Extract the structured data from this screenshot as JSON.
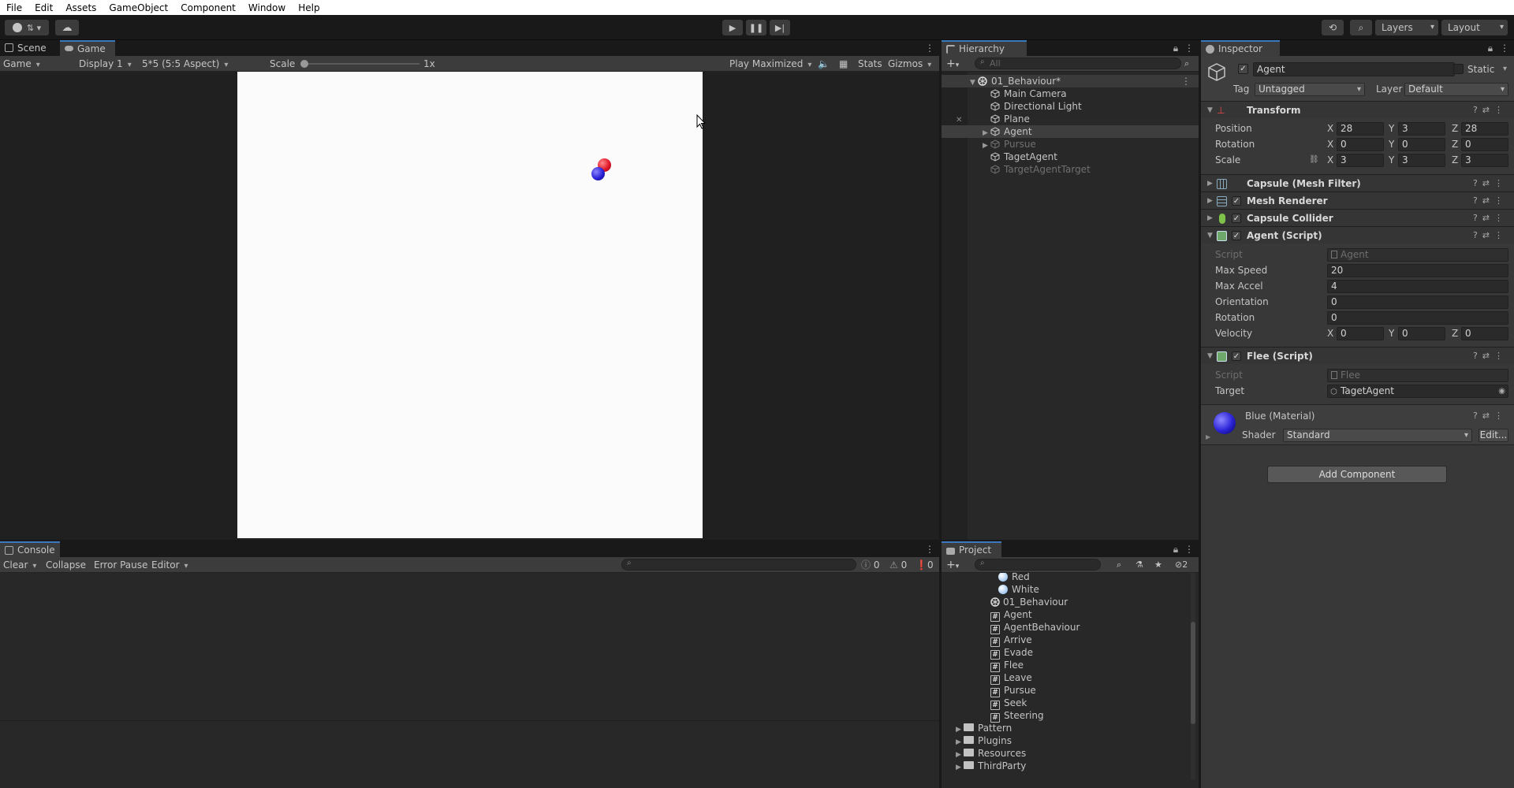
{
  "menu": [
    "File",
    "Edit",
    "Assets",
    "GameObject",
    "Component",
    "Window",
    "Help"
  ],
  "toolbar": {
    "layers": "Layers",
    "layout": "Layout"
  },
  "scene_tabs": {
    "scene": "Scene",
    "game": "Game"
  },
  "game_toolbar": {
    "mode": "Game",
    "display": "Display 1",
    "aspect": "5*5 (5:5 Aspect)",
    "scale_label": "Scale",
    "scale_value": "1x",
    "play_mode": "Play Maximized",
    "stats": "Stats",
    "gizmos": "Gizmos"
  },
  "game_view": {
    "background": "#fbfbfb",
    "agent_color": "#2a22d6",
    "target_color": "#e0192b"
  },
  "hierarchy": {
    "tab": "Hierarchy",
    "search_placeholder": "All",
    "items": [
      {
        "label": "01_Behaviour*",
        "depth": 0,
        "scene": true
      },
      {
        "label": "Main Camera",
        "depth": 1
      },
      {
        "label": "Directional Light",
        "depth": 1
      },
      {
        "label": "Plane",
        "depth": 1
      },
      {
        "label": "Agent",
        "depth": 1,
        "selected": true,
        "expandable": true
      },
      {
        "label": "Pursue",
        "depth": 1,
        "dim": true,
        "expandable": true
      },
      {
        "label": "TagetAgent",
        "depth": 1
      },
      {
        "label": "TargetAgentTarget",
        "depth": 1,
        "dim": true
      }
    ]
  },
  "inspector": {
    "tab": "Inspector",
    "object_name": "Agent",
    "static_label": "Static",
    "tag_label": "Tag",
    "tag_value": "Untagged",
    "layer_label": "Layer",
    "layer_value": "Default",
    "transform": {
      "title": "Transform",
      "position": {
        "label": "Position",
        "x": "28",
        "y": "3",
        "z": "28"
      },
      "rotation": {
        "label": "Rotation",
        "x": "0",
        "y": "0",
        "z": "0"
      },
      "scale": {
        "label": "Scale",
        "x": "3",
        "y": "3",
        "z": "3"
      }
    },
    "components": {
      "mesh_filter": "Capsule (Mesh Filter)",
      "mesh_renderer": "Mesh Renderer",
      "capsule_collider": "Capsule Collider",
      "agent_script": "Agent (Script)",
      "flee_script": "Flee (Script)"
    },
    "agent": {
      "script_label": "Script",
      "script_value": "Agent",
      "max_speed_label": "Max Speed",
      "max_speed": "20",
      "max_accel_label": "Max Accel",
      "max_accel": "4",
      "orientation_label": "Orientation",
      "orientation": "0",
      "rotation_label": "Rotation",
      "rotation": "0",
      "velocity_label": "Velocity",
      "vx": "0",
      "vy": "0",
      "vz": "0"
    },
    "flee": {
      "script_label": "Script",
      "script_value": "Flee",
      "target_label": "Target",
      "target_value": "TagetAgent"
    },
    "material": {
      "name": "Blue (Material)",
      "shader_label": "Shader",
      "shader_value": "Standard",
      "edit": "Edit..."
    },
    "add_component": "Add Component"
  },
  "console": {
    "tab": "Console",
    "clear": "Clear",
    "collapse": "Collapse",
    "error_pause": "Error Pause",
    "editor": "Editor",
    "logs": "0",
    "warnings": "0",
    "errors": "0"
  },
  "project": {
    "tab": "Project",
    "hidden_count": "2",
    "items": [
      {
        "label": "Red",
        "type": "material"
      },
      {
        "label": "White",
        "type": "material"
      },
      {
        "label": "01_Behaviour",
        "type": "scene"
      },
      {
        "label": "Agent",
        "type": "script"
      },
      {
        "label": "AgentBehaviour",
        "type": "script"
      },
      {
        "label": "Arrive",
        "type": "script"
      },
      {
        "label": "Evade",
        "type": "script"
      },
      {
        "label": "Flee",
        "type": "script"
      },
      {
        "label": "Leave",
        "type": "script"
      },
      {
        "label": "Pursue",
        "type": "script"
      },
      {
        "label": "Seek",
        "type": "script"
      },
      {
        "label": "Steering",
        "type": "script"
      },
      {
        "label": "Pattern",
        "type": "folder"
      },
      {
        "label": "Plugins",
        "type": "folder"
      },
      {
        "label": "Resources",
        "type": "folder"
      },
      {
        "label": "ThirdParty",
        "type": "folder"
      }
    ]
  }
}
